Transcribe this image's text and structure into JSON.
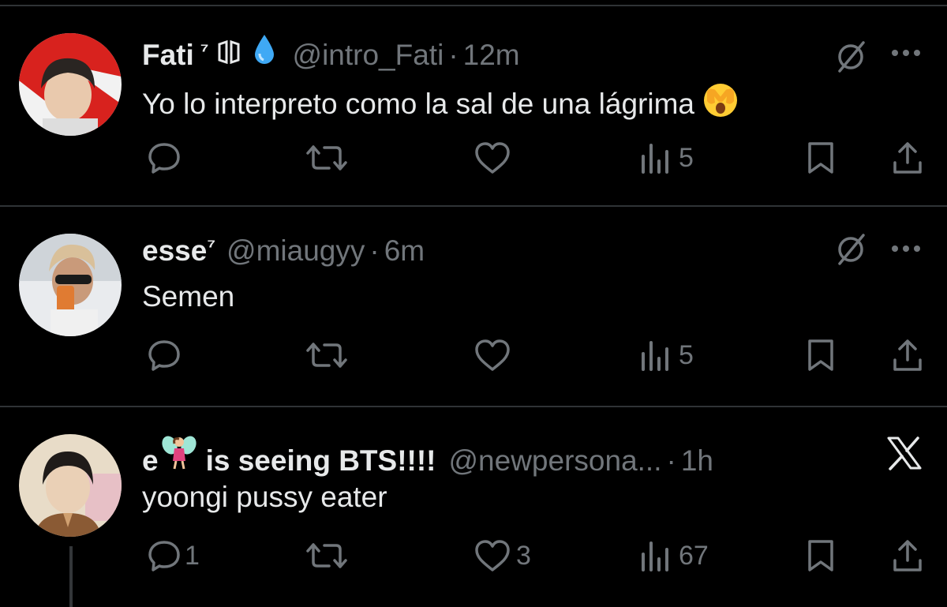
{
  "tweets": [
    {
      "author_name": "Fati",
      "name_suffix": "⁷",
      "handle": "@intro_Fati",
      "separator": "·",
      "time": "12m",
      "text": "Yo lo interpreto como la sal de una lágrima",
      "emoji_icon": "face-covering-eyes-emoji",
      "badge_icons": [
        "bts-logo-icon",
        "droplet-icon"
      ],
      "top_right_icons": [
        "grok-icon",
        "more-icon"
      ],
      "actions": {
        "reply": "",
        "retweet": "",
        "like": "",
        "views": "5"
      }
    },
    {
      "author_name": "esse",
      "name_suffix": "⁷",
      "handle": "@miaugyy",
      "separator": "·",
      "time": "6m",
      "text": "Semen",
      "top_right_icons": [
        "grok-icon",
        "more-icon"
      ],
      "actions": {
        "reply": "",
        "retweet": "",
        "like": "",
        "views": "5"
      }
    },
    {
      "author_name_prefix": "e",
      "author_name_suffix": "is seeing BTS!!!!",
      "name_emoji_icon": "fairy-emoji",
      "handle": "@newpersona...",
      "separator": "·",
      "time": "1h",
      "text": "yoongi pussy eater",
      "top_right_icons": [
        "x-logo-icon"
      ],
      "actions": {
        "reply": "1",
        "retweet": "",
        "like": "3",
        "views": "67"
      }
    }
  ],
  "colors": {
    "background": "#000000",
    "text": "#e7e9ea",
    "secondary": "#71767b",
    "divider": "#2f3336"
  }
}
